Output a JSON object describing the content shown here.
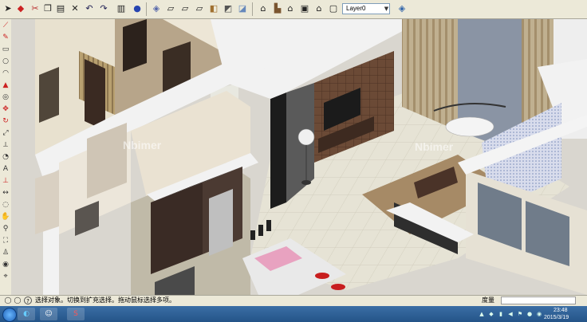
{
  "toolbar": {
    "layer_value": "Layer0",
    "icons": [
      "select-arrow-icon",
      "eraser-icon",
      "paint-icon",
      "cut-icon",
      "copy-icon",
      "paste-icon",
      "delete-icon",
      "undo-icon",
      "redo-icon",
      "print-icon",
      "model-info-icon",
      "iso-view-icon",
      "top-view-icon",
      "front-view-icon",
      "right-view-icon",
      "back-view-icon",
      "left-view-icon",
      "xray-style-icon",
      "wireframe-style-icon",
      "hidden-line-style-icon",
      "shaded-style-icon",
      "shaded-texture-style-icon",
      "monochrome-style-icon",
      "house-icon-1",
      "house-icon-2",
      "house-icon-3",
      "house-icon-4",
      "house-icon-5",
      "house-icon-6",
      "layer-manager-icon"
    ]
  },
  "left_tools": [
    "line-tool-icon",
    "pencil-tool-icon",
    "rectangle-tool-icon",
    "circle-tool-icon",
    "arc-tool-icon",
    "push-pull-tool-icon",
    "offset-tool-icon",
    "move-tool-icon",
    "rotate-tool-icon",
    "scale-tool-icon",
    "tape-measure-tool-icon",
    "protractor-tool-icon",
    "text-tool-icon",
    "axes-tool-icon",
    "dimension-tool-icon",
    "orbit-tool-icon",
    "pan-tool-icon",
    "zoom-tool-icon",
    "zoom-extents-tool-icon",
    "walk-tool-icon",
    "look-around-tool-icon",
    "position-camera-tool-icon"
  ],
  "watermark": {
    "left": "Nbimer",
    "right": "Nbimer"
  },
  "status": {
    "text": "选择对象。切换到扩充选择。拖动鼠标选择多项。",
    "label": "度量",
    "value": ""
  },
  "taskbar": {
    "apps": [
      "start-orb",
      "chrome-app",
      "person-app",
      "sketchup-app"
    ],
    "time": "23:48",
    "date": "2015/3/19"
  },
  "colors": {
    "chrome": "#ece9d8",
    "viewport_bg": "#e4e4e4",
    "floor_tile": "#e6e3d5",
    "rug": "#a68a66",
    "dark_wood": "#3a2b25",
    "wall_cap": "#f2f2f2"
  }
}
